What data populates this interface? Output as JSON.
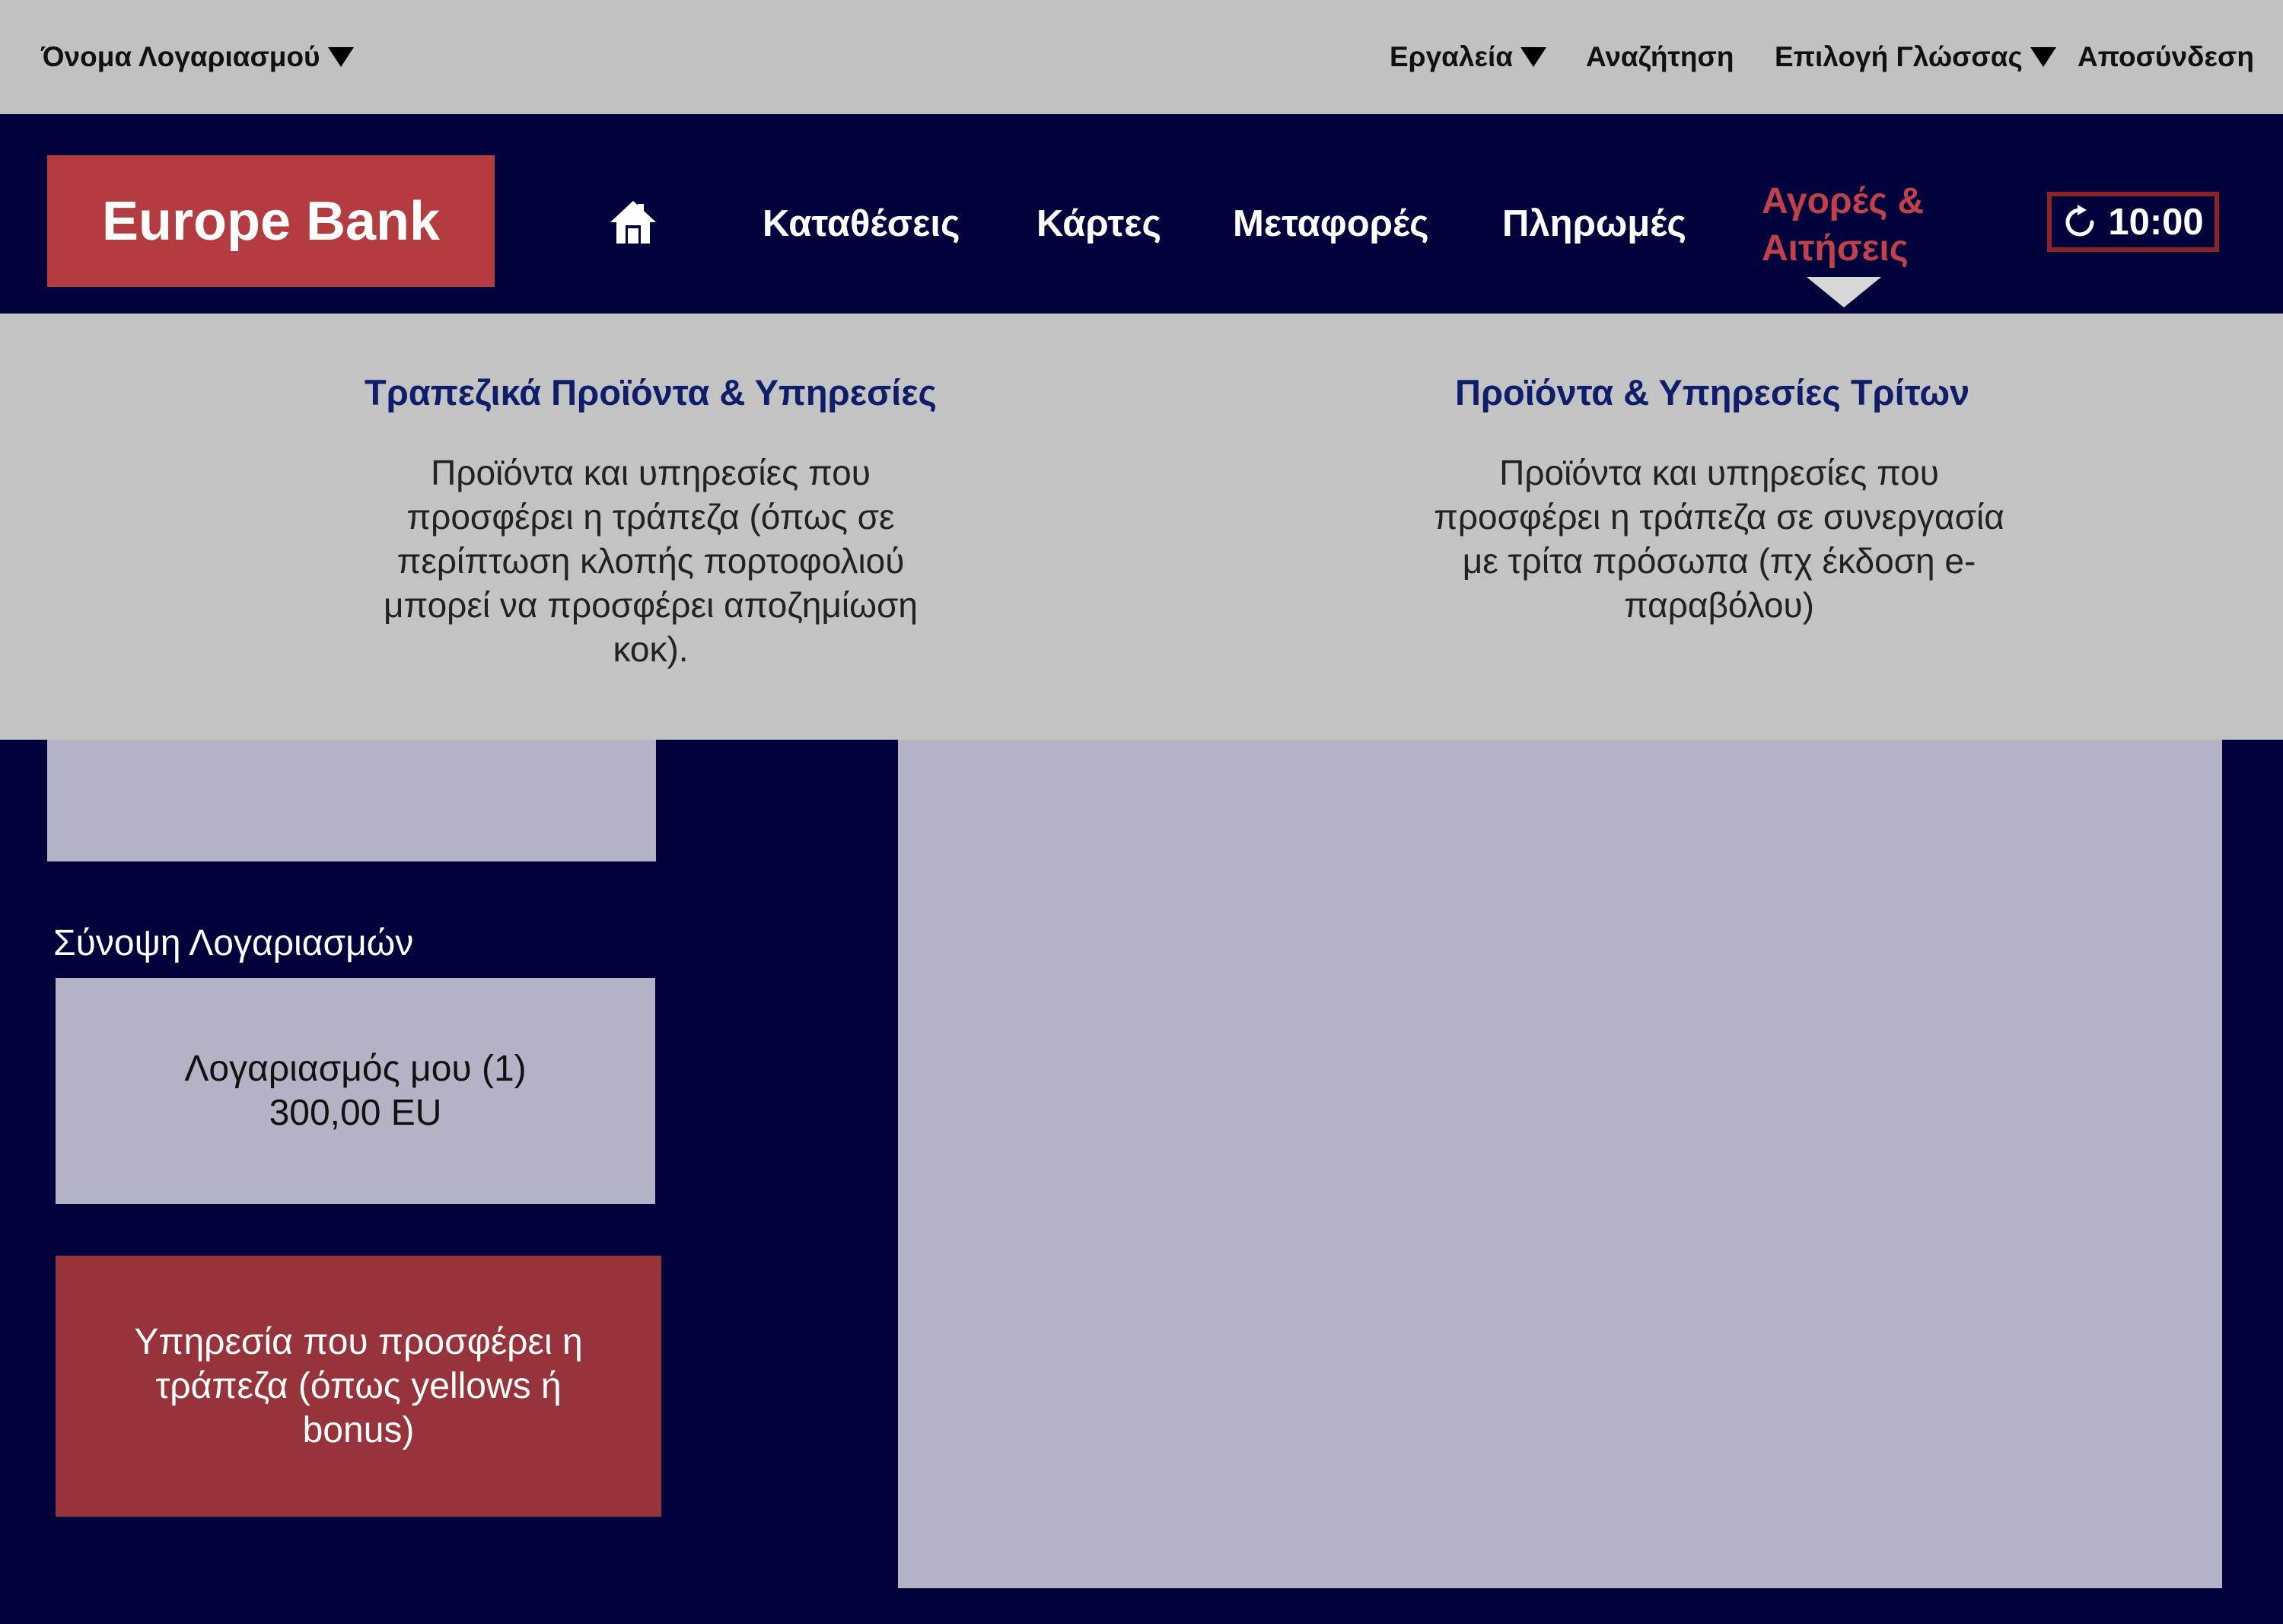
{
  "colors": {
    "navy": "#00033b",
    "accent_red": "#b43c40",
    "active_nav": "#c2404a",
    "panel_light": "#b3b3c5",
    "menu_grey": "#c3c3c3",
    "dropdown_title": "#0e1e6b"
  },
  "topbar": {
    "account_name": "Όνομα Λογαριασμού",
    "tools": "Εργαλεία",
    "search": "Αναζήτηση",
    "language": "Επιλογή Γλώσσας",
    "logout": "Αποσύνδεση"
  },
  "navbar": {
    "logo": "Europe Bank",
    "home_icon": "home-icon",
    "items": [
      "Καταθέσεις",
      "Κάρτες",
      "Μεταφορές",
      "Πληρωμές"
    ],
    "active_item": "Αγορές & Αιτήσεις",
    "timer_icon": "refresh-icon",
    "timer": "10:00"
  },
  "dropdown": {
    "columns": [
      {
        "title": "Τραπεζικά Προϊόντα & Υπηρεσίες",
        "description": "Προϊόντα και υπηρεσίες που προσφέρει η τράπεζα (όπως σε περίπτωση κλοπής πορτοφολιού μπορεί να προσφέρει αποζημίωση κοκ)."
      },
      {
        "title": "Προϊόντα & Υπηρεσίες Τρίτων",
        "description": "Προϊόντα και υπηρεσίες που προσφέρει η τράπεζα σε συνεργασία με τρίτα πρόσωπα (πχ έκδοση e-παραβόλου)"
      }
    ]
  },
  "main": {
    "summary_title": "Σύνοψη Λογαριασμών",
    "account": {
      "name": "Λογαριασμός μου (1)",
      "balance": "300,00 EU"
    },
    "promo": "Υπηρεσία που προσφέρει η τράπεζα (όπως yellows ή bonus)"
  }
}
